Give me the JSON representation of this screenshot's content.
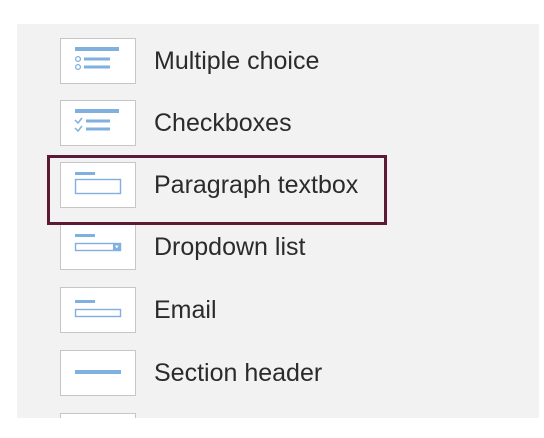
{
  "field_types": {
    "items": [
      {
        "label": "Multiple choice",
        "icon": "multiple-choice-icon"
      },
      {
        "label": "Checkboxes",
        "icon": "checkboxes-icon"
      },
      {
        "label": "Paragraph textbox",
        "icon": "paragraph-textbox-icon",
        "selected": true
      },
      {
        "label": "Dropdown list",
        "icon": "dropdown-list-icon"
      },
      {
        "label": "Email",
        "icon": "email-icon"
      },
      {
        "label": "Section header",
        "icon": "section-header-icon"
      }
    ]
  },
  "colors": {
    "icon_accent": "#7fb0e0",
    "highlight_border": "#5c1a35",
    "panel_background": "#f2f2f2",
    "text": "#2b2b2b"
  }
}
